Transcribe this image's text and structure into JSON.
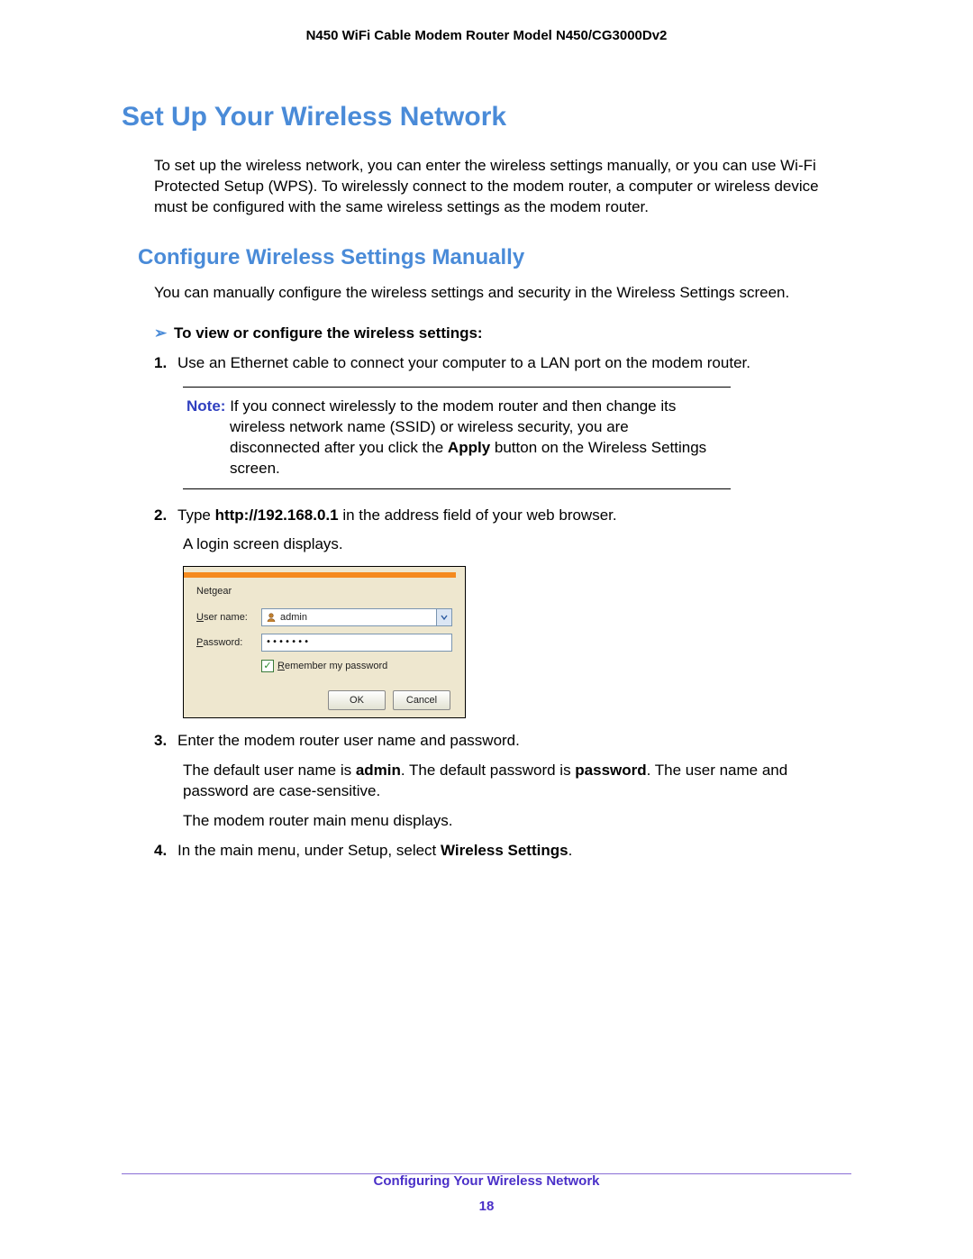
{
  "header": {
    "model_line": "N450 WiFi Cable Modem Router Model N450/CG3000Dv2"
  },
  "h1": "Set Up Your Wireless Network",
  "intro": "To set up the wireless network, you can enter the wireless settings manually, or you can use Wi-Fi Protected Setup (WPS). To wirelessly connect to the modem router, a computer or wireless device must be configured with the same wireless settings as the modem router.",
  "h2": "Configure Wireless Settings Manually",
  "sub_intro": "You can manually configure the wireless settings and security in the Wireless Settings screen.",
  "procedure_title": "To view or configure the wireless settings:",
  "steps": {
    "s1": "Use an Ethernet cable to connect your computer to a LAN port on the modem router.",
    "note_label": "Note:",
    "note_first": "If you connect wirelessly to the modem router and then change its",
    "note_cont1": "wireless network name (SSID) or wireless security, you are",
    "note_cont2_a": "disconnected after you click the ",
    "note_cont2_b": "Apply",
    "note_cont2_c": " button on the Wireless Settings",
    "note_cont3": "screen.",
    "s2_a": "Type ",
    "s2_b": "http://192.168.0.1",
    "s2_c": " in the address field of your web browser.",
    "s2_p": "A login screen displays.",
    "s3_a": "Enter the modem router user name and password.",
    "s3_p1_a": "The default user name is ",
    "s3_p1_b": "admin",
    "s3_p1_c": ". The default password is ",
    "s3_p1_d": "password",
    "s3_p1_e": ". The user name and password are case-sensitive.",
    "s3_p2": "The modem router main menu displays.",
    "s4_a": "In the main menu, under Setup, select ",
    "s4_b": "Wireless Settings",
    "s4_c": "."
  },
  "login": {
    "title": "Netgear",
    "user_label_u": "U",
    "user_label_rest": "ser name:",
    "pass_label_u": "P",
    "pass_label_rest": "assword:",
    "user_value": "admin",
    "pass_dots": "•••••••",
    "remember_u": "R",
    "remember_rest": "emember my password",
    "ok": "OK",
    "cancel": "Cancel"
  },
  "footer": {
    "section": "Configuring Your Wireless Network",
    "page": "18"
  }
}
